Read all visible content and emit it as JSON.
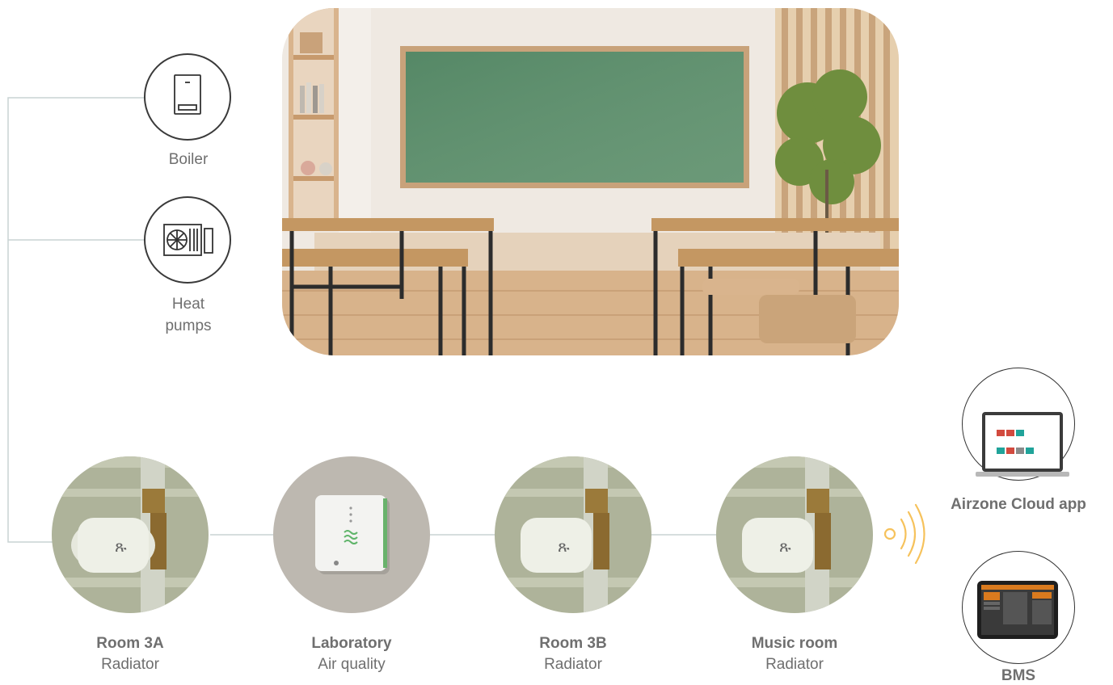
{
  "equipment": [
    {
      "id": "boiler",
      "label": "Boiler",
      "icon": "boiler-icon"
    },
    {
      "id": "heat-pumps",
      "label_line1": "Heat",
      "label_line2": "pumps",
      "icon": "heat-pump-icon"
    }
  ],
  "scene": {
    "image": "classroom-photo"
  },
  "devices": [
    {
      "id": "room-3a",
      "title": "Room 3A",
      "subtitle": "Radiator",
      "image": "thermostatic-valve"
    },
    {
      "id": "laboratory",
      "title": "Laboratory",
      "subtitle": "Air quality",
      "image": "air-quality-sensor"
    },
    {
      "id": "room-3b",
      "title": "Room 3B",
      "subtitle": "Radiator",
      "image": "thermostatic-valve"
    },
    {
      "id": "music-room",
      "title": "Music room",
      "subtitle": "Radiator",
      "image": "thermostatic-valve"
    }
  ],
  "destinations": [
    {
      "id": "cloud-app",
      "label": "Airzone Cloud app",
      "image": "laptop-dashboard"
    },
    {
      "id": "bms",
      "label": "BMS",
      "image": "tablet-bms"
    }
  ],
  "colors": {
    "line": "#c9d3d3",
    "text": "#6f6f6f",
    "wifi": "#f6c25c",
    "chalkboard": "#5e8f6c",
    "wood": "#c8a27a"
  }
}
